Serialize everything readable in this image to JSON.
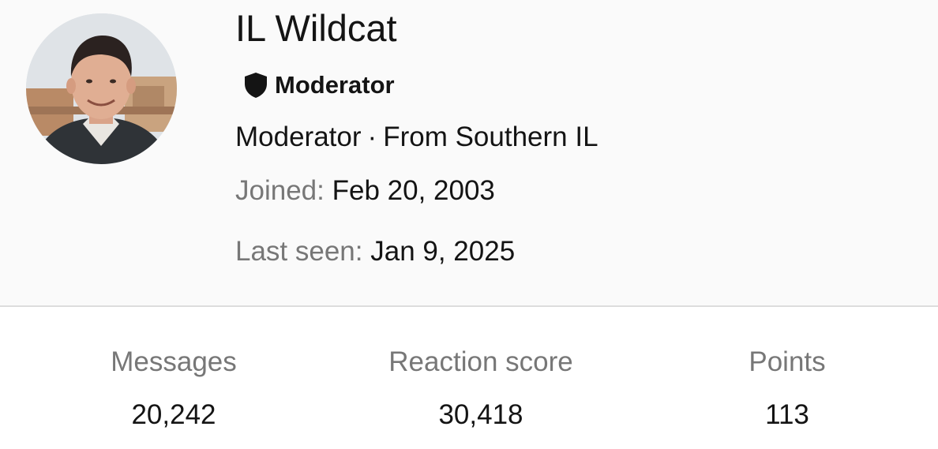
{
  "profile": {
    "username": "IL Wildcat",
    "role_badge": {
      "icon": "shield-icon",
      "label": "Moderator"
    },
    "tagline": {
      "title": "Moderator",
      "separator": "·",
      "location": "From Southern IL"
    },
    "joined": {
      "label": "Joined:",
      "value": "Feb 20, 2003"
    },
    "last_seen": {
      "label": "Last seen:",
      "value": "Jan 9, 2025"
    }
  },
  "stats": [
    {
      "label": "Messages",
      "value": "20,242"
    },
    {
      "label": "Reaction score",
      "value": "30,418"
    },
    {
      "label": "Points",
      "value": "113"
    }
  ],
  "colors": {
    "header_background": "#fafafa",
    "primary_text": "#141414",
    "muted_text": "#777777",
    "divider": "#dddddd"
  }
}
